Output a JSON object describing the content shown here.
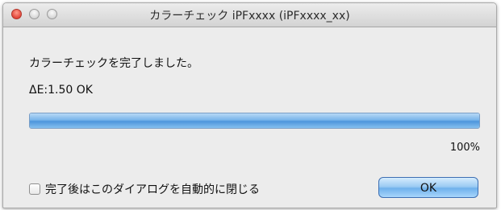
{
  "window": {
    "title": "カラーチェック iPFxxxx (iPFxxxx_xx)"
  },
  "main": {
    "message": "カラーチェックを完了しました。",
    "delta_e": "ΔE:1.50 OK",
    "progress_fraction": 1.0,
    "progress_label": "100%",
    "checkbox_label": "完了後はこのダイアログを自動的に閉じる",
    "checkbox_checked": false,
    "ok_label": "OK"
  },
  "colors": {
    "accent": "#5aa3e6",
    "close_light": "#e2463a"
  }
}
